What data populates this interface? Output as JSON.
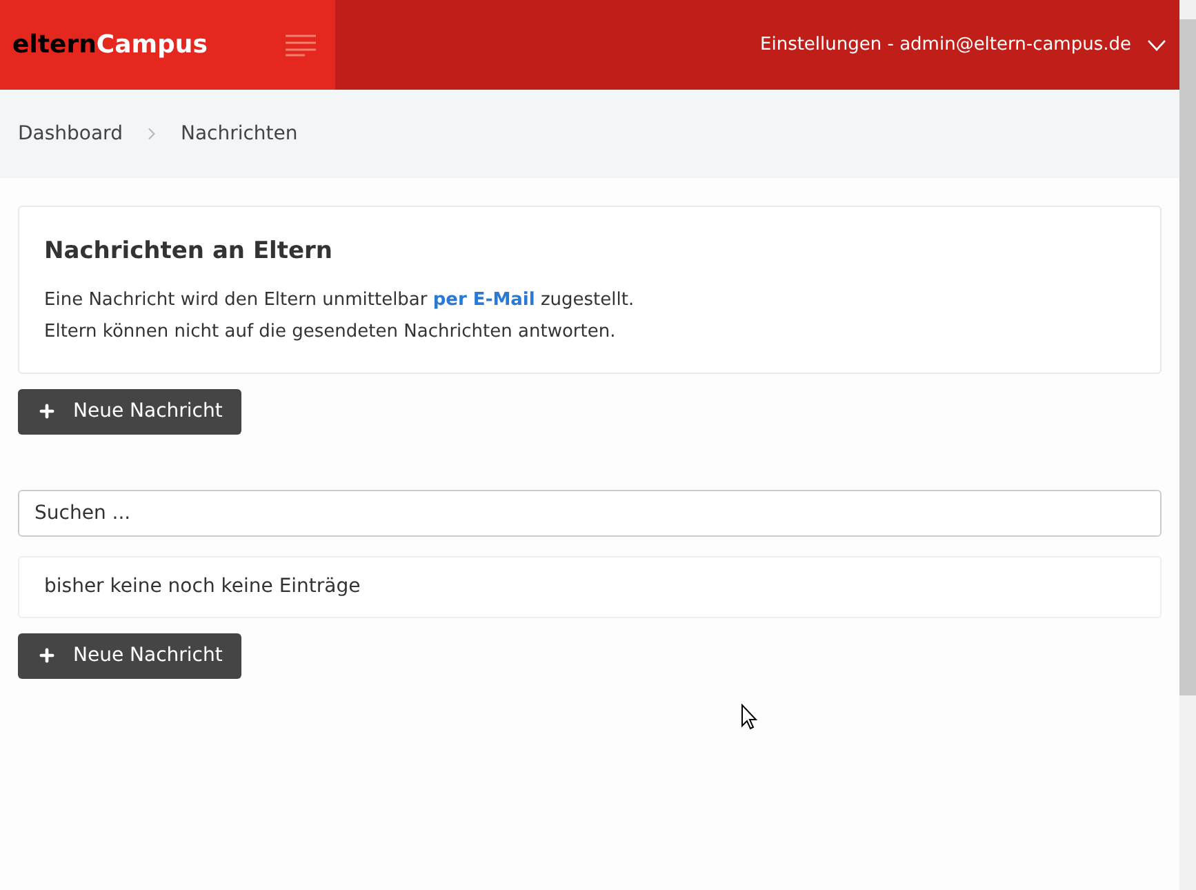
{
  "header": {
    "logo": {
      "dark_part": "eltern",
      "light_part": "Campus"
    },
    "user_menu": "Einstellungen - admin@eltern-campus.de"
  },
  "breadcrumb": [
    "Dashboard",
    "Nachrichten"
  ],
  "info_card": {
    "title": "Nachrichten an Eltern",
    "lines": [
      "Eine Nachricht wird den Eltern unmittelbar **per E-Mail** zugestellt.",
      "Eltern können nicht auf die gesendeten Nachrichten antworten."
    ]
  },
  "new_button_top": {
    "label": "Neue Nachricht"
  },
  "search": {
    "placeholder": "Suchen ..."
  },
  "empty_message": "bisher keine noch keine Einträge",
  "new_button_bottom": {
    "label": "Neue Nachricht"
  }
}
